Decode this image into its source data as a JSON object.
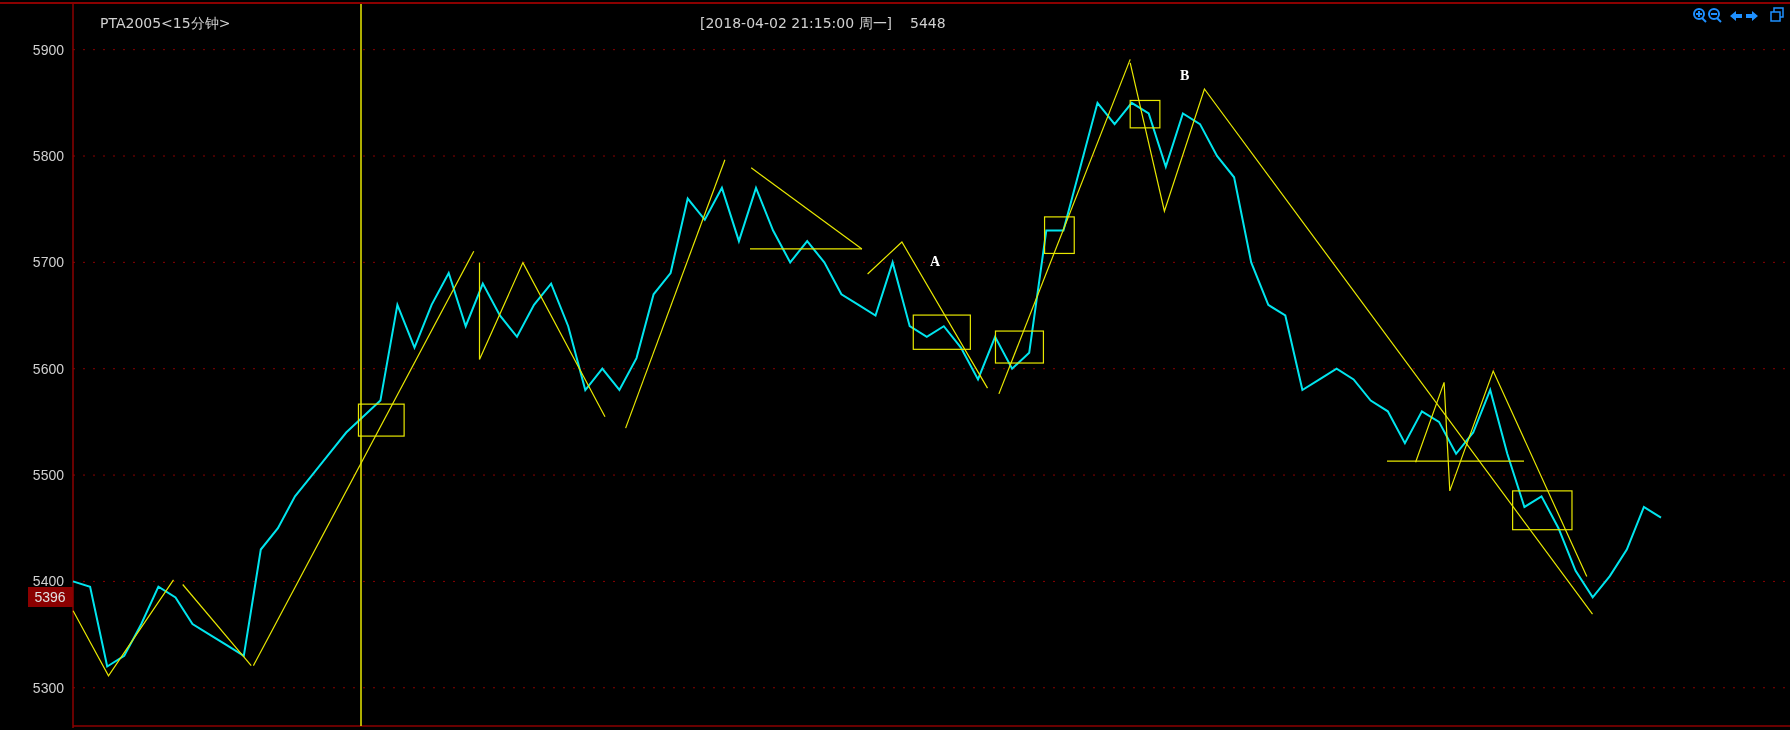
{
  "header": {
    "symbol": "PTA2005<15分钟>",
    "datetime": "[2018-04-02  21:15:00 周一]",
    "price": "5448"
  },
  "price_tag": {
    "label": "5396"
  },
  "chart_data": {
    "type": "line",
    "grid": true,
    "ylim": [
      5265,
      5942
    ],
    "yticks": [
      5300,
      5400,
      5500,
      5600,
      5700,
      5800,
      5900
    ],
    "series": [
      {
        "color": "#00e5ee",
        "values": [
          5400,
          5395,
          5320,
          5330,
          5360,
          5395,
          5385,
          5360,
          5350,
          5340,
          5330,
          5430,
          5450,
          5480,
          5500,
          5520,
          5540,
          5555,
          5570,
          5660,
          5620,
          5660,
          5690,
          5640,
          5680,
          5650,
          5630,
          5660,
          5680,
          5640,
          5580,
          5600,
          5580,
          5610,
          5670,
          5690,
          5760,
          5740,
          5770,
          5720,
          5770,
          5730,
          5700,
          5720,
          5700,
          5670,
          5660,
          5650,
          5700,
          5640,
          5630,
          5640,
          5620,
          5590,
          5630,
          5600,
          5615,
          5730,
          5730,
          5790,
          5850,
          5830,
          5850,
          5840,
          5790,
          5840,
          5830,
          5800,
          5780,
          5700,
          5660,
          5650,
          5580,
          5590,
          5600,
          5590,
          5570,
          5560,
          5530,
          5560,
          5550,
          5520,
          5540,
          5580,
          5520,
          5470,
          5480,
          5450,
          5410,
          5385,
          5405,
          5430,
          5470,
          5460
        ]
      }
    ],
    "annotations": [
      "A",
      "B"
    ]
  }
}
